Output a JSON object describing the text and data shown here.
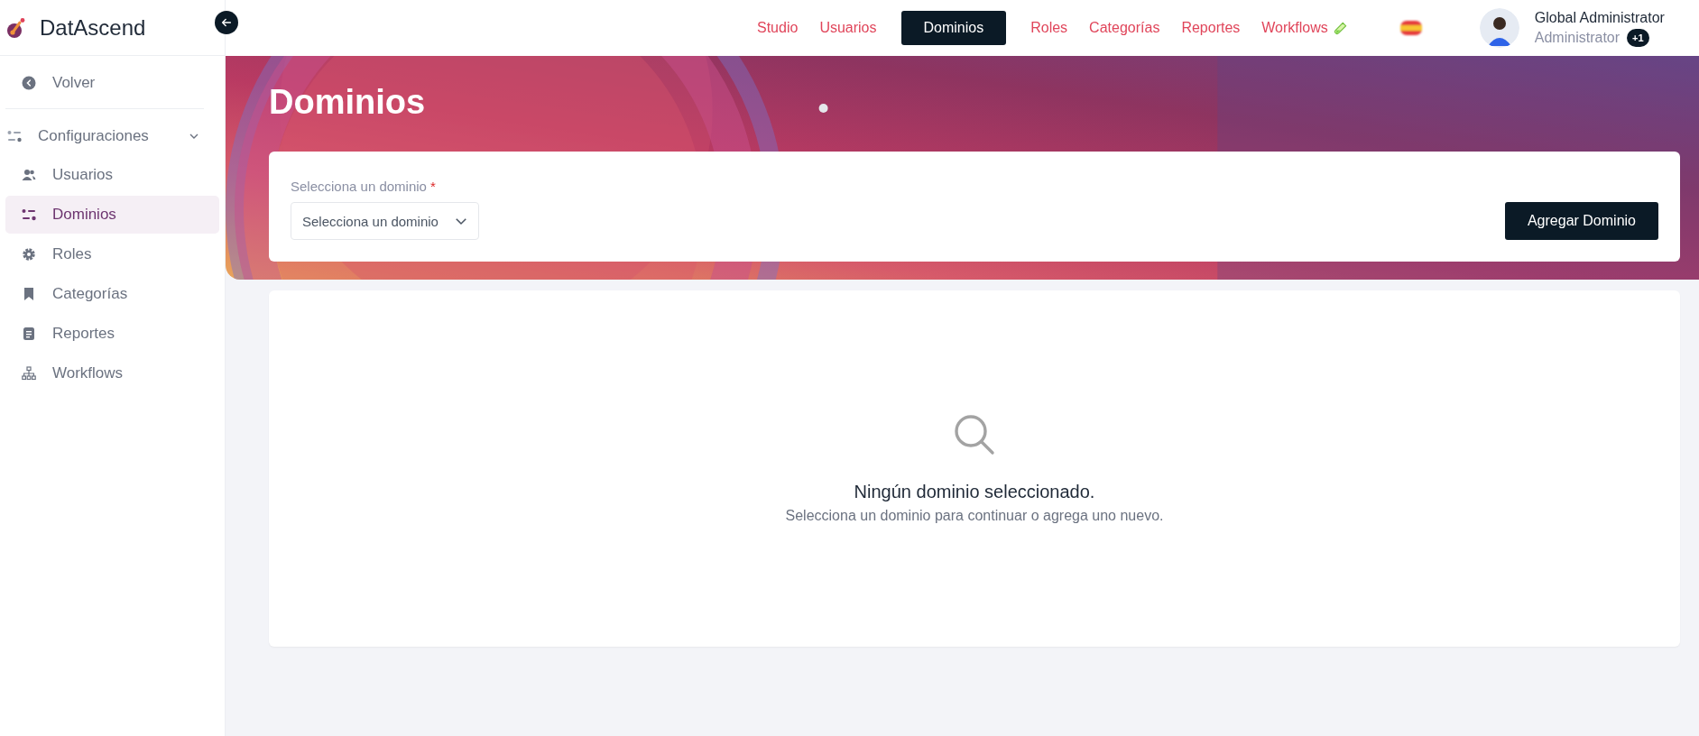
{
  "brand": {
    "name": "DatAscend"
  },
  "sidebar": {
    "back": "Volver",
    "section": {
      "label": "Configuraciones",
      "expanded": true,
      "children": [
        {
          "label": "Usuarios",
          "selected": false
        },
        {
          "label": "Dominios",
          "selected": true
        },
        {
          "label": "Roles",
          "selected": false
        },
        {
          "label": "Categorías",
          "selected": false
        },
        {
          "label": "Reportes",
          "selected": false
        },
        {
          "label": "Workflows",
          "selected": false
        }
      ]
    }
  },
  "nav": [
    {
      "label": "Studio",
      "selected": false
    },
    {
      "label": "Usuarios",
      "selected": false
    },
    {
      "label": "Dominios",
      "selected": true
    },
    {
      "label": "Roles",
      "selected": false
    },
    {
      "label": "Categorías",
      "selected": false
    },
    {
      "label": "Reportes",
      "selected": false
    },
    {
      "label": "Workflows",
      "selected": false
    }
  ],
  "user": {
    "name": "Global Administrator",
    "role": "Administrator",
    "extra_roles": "+1"
  },
  "page": {
    "title": "Dominios"
  },
  "form": {
    "label": "Selecciona un dominio",
    "required_mark": "*",
    "select": {
      "placeholder": "Selecciona un dominio"
    },
    "add_button": "Agregar Dominio"
  },
  "empty_state": {
    "title": "Ningún dominio seleccionado.",
    "message": "Selecciona un dominio para continuar o agrega uno nuevo."
  }
}
